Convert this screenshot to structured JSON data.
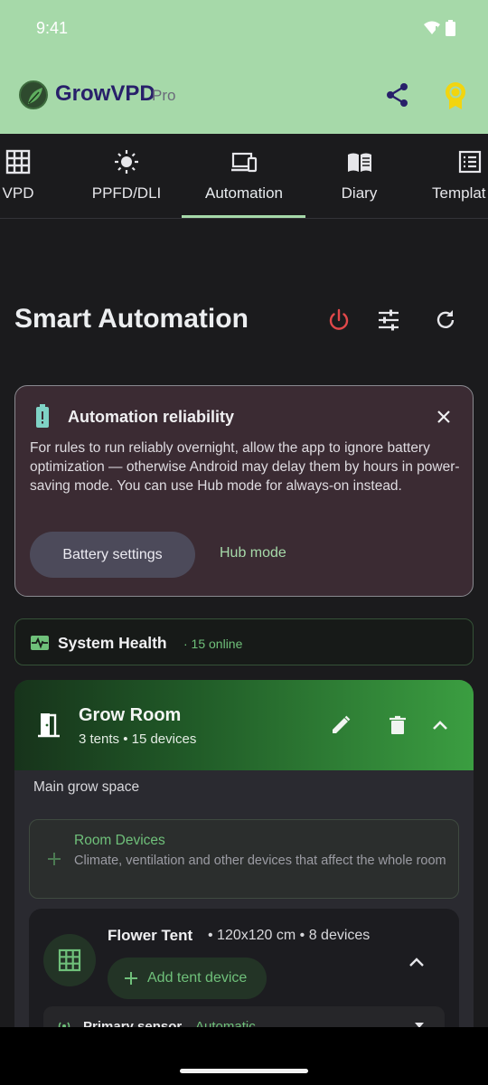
{
  "status_bar": {
    "time": "9:41"
  },
  "app_bar": {
    "title": "GrowVPD",
    "badge": "Pro",
    "share_icon": "share-icon",
    "award_icon": "award-icon"
  },
  "tabs": [
    {
      "label": "VPD",
      "icon": "grid-icon"
    },
    {
      "label": "PPFD/DLI",
      "icon": "sun-icon"
    },
    {
      "label": "Automation",
      "icon": "devices-icon",
      "active": true
    },
    {
      "label": "Diary",
      "icon": "book-icon"
    },
    {
      "label": "Templat",
      "icon": "list-icon"
    }
  ],
  "header": {
    "title": "Smart Automation"
  },
  "reliability": {
    "title": "Automation reliability",
    "body": "For rules to run reliably overnight, allow the app to ignore battery optimization — otherwise Android may delay them by hours in power-saving mode. You can use Hub mode for always-on instead.",
    "battery_button": "Battery settings",
    "hub_button": "Hub mode"
  },
  "health": {
    "title": "System Health",
    "status": "· 15 online"
  },
  "room": {
    "name": "Grow Room",
    "summary": "3 tents • 15 devices",
    "description": "Main grow space",
    "devices_title": "Room Devices",
    "devices_text": "Climate, ventilation and other devices that affect the whole room"
  },
  "tent": {
    "name": "Flower Tent",
    "meta": "• 120x120 cm • 8 devices",
    "add_button": "Add tent device",
    "sensor_label": "Primary sensor",
    "sensor_mode": "Automatic"
  },
  "colors": {
    "accent": "#a6d9a9",
    "green_text": "#6fc07a",
    "power_red": "#e0484a",
    "title_purple": "#28206a"
  }
}
